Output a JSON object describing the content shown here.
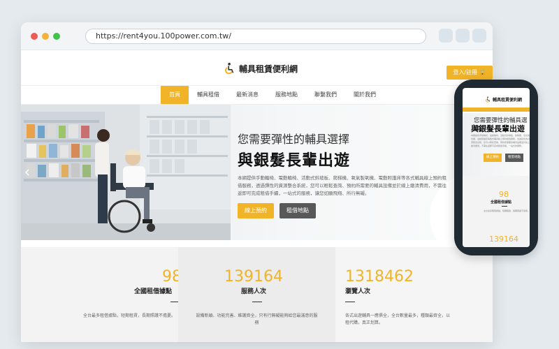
{
  "browser": {
    "url": "https://rent4you.100power.com.tw/"
  },
  "site": {
    "logo_text": "輔具租賃便利網",
    "login_label": "登入/註冊 🔒",
    "nav": [
      "首頁",
      "輔具租借",
      "最新消息",
      "服務地點",
      "聯繫我們",
      "關於我們"
    ]
  },
  "hero": {
    "subtitle": "您需要彈性的輔具選擇",
    "title": "與銀髮長輩出遊",
    "desc": "本網提供手動輪椅、電動輪椅、活動式斜坡板、爬梯機、氧氣製氧機、電動照護床等各式輔具線上預約租借服務，透過彈性的資源整合系統，您可以輕鬆查詢、預約所需要的輔具設備並於線上繳清費用，不需往返即可完成租借手續，一站式的服務，讓您如願飛翔、所行無礙。",
    "btn_reserve": "線上預約",
    "btn_locations": "租借地點"
  },
  "stats": [
    {
      "number": "98",
      "label": "全國租借據點",
      "desc": "全台最多租借據點，短期租賃，長期照護不擔憂。"
    },
    {
      "number": "139164",
      "label": "服務人次",
      "desc": "設備新穎、功能完善、維護齊全，只有行無礙能夠給您最滿意的服務"
    },
    {
      "number": "1318462",
      "label": "瀏覽人次",
      "desc": "各式出遊輔具一應俱全，全台數量最多，種類最齊全，以租代購，真正划算。"
    }
  ],
  "phone": {
    "logo_text": "輔具租賃便利網",
    "subtitle": "您需要彈性的輔具選擇",
    "title": "與銀髮長輩出遊",
    "desc": "本網提供手動輪椅、電動輪椅、活動式斜坡板、爬梯機、氧氣製氧機、電動照護床等各式輔具線上預約租借服務，透過彈性的資源整合系統，您可以輕鬆查詢、預約所需要的輔具設備並於線上繳清費用，不需往返即可完成租借手續，一站式的服務。",
    "btn_reserve": "線上預約",
    "btn_locations": "租借地點",
    "stat_number": "98",
    "stat_label": "全國租借據點",
    "stat_desc": "全台最多租借據點，短期租賃，長期照護不擔憂。",
    "stat_number2": "139164"
  },
  "colors": {
    "accent": "#f1b327",
    "dark_button": "#585858",
    "phone_frame": "#1f2a33"
  }
}
